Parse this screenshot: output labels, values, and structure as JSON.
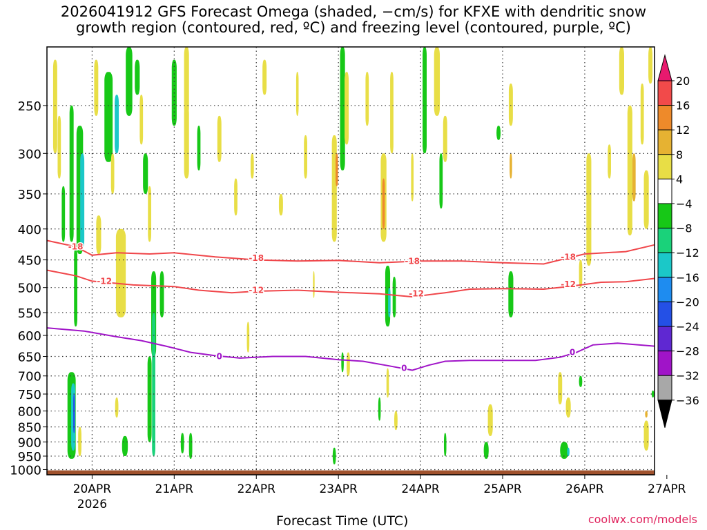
{
  "title": {
    "line1": "2026041912 GFS Forecast Omega (shaded, −cm/s) for KFXE with dendritic snow",
    "line2": "growth region (contoured, red, ºC) and freezing level (contoured, purple, ºC)"
  },
  "credit": "coolwx.com/models",
  "chart_data": {
    "type": "heatmap",
    "xlabel": "Forecast Time (UTC)",
    "ylabel": "",
    "x_ticks": [
      "20APR",
      "21APR",
      "22APR",
      "23APR",
      "24APR",
      "25APR",
      "26APR",
      "27APR"
    ],
    "x_sublabel": {
      "tick": "20APR",
      "text": "2026"
    },
    "x_range_days": [
      -0.55,
      6.85
    ],
    "y_ticks": [
      250,
      300,
      350,
      400,
      450,
      500,
      550,
      600,
      650,
      700,
      750,
      800,
      850,
      900,
      950,
      1000
    ],
    "y_range_hpa": [
      200,
      1020
    ],
    "grid": true,
    "colorbar": {
      "labels": [
        20,
        16,
        12,
        8,
        4,
        -4,
        -8,
        -12,
        -16,
        -20,
        -24,
        -28,
        -32,
        -36
      ],
      "colors": [
        "#e8196e",
        "#f24a4a",
        "#ee8a2a",
        "#e6b232",
        "#e8de46",
        "#ffffff",
        "#17c817",
        "#1ad27a",
        "#1bc8c8",
        "#1e8cf0",
        "#2450e6",
        "#5f28d2",
        "#a014c8",
        "#a8a8a8",
        "#000000"
      ]
    },
    "contours": [
      {
        "label": "-18",
        "color": "#f0464a",
        "kind": "dendritic",
        "points": [
          [
            -0.55,
            418
          ],
          [
            -0.2,
            428
          ],
          [
            0,
            442
          ],
          [
            0.3,
            438
          ],
          [
            0.7,
            440
          ],
          [
            1.0,
            438
          ],
          [
            1.5,
            445
          ],
          [
            2.0,
            450
          ],
          [
            2.5,
            452
          ],
          [
            3.0,
            451
          ],
          [
            3.5,
            455
          ],
          [
            4.0,
            452
          ],
          [
            4.5,
            452
          ],
          [
            5.0,
            455
          ],
          [
            5.5,
            457
          ],
          [
            5.7,
            450
          ],
          [
            6.0,
            440
          ],
          [
            6.5,
            436
          ],
          [
            6.85,
            425
          ]
        ]
      },
      {
        "label": "-12",
        "color": "#f0464a",
        "kind": "dendritic",
        "points": [
          [
            -0.55,
            468
          ],
          [
            -0.2,
            478
          ],
          [
            0,
            488
          ],
          [
            0.5,
            495
          ],
          [
            1.0,
            498
          ],
          [
            1.3,
            505
          ],
          [
            1.7,
            510
          ],
          [
            2.0,
            507
          ],
          [
            2.5,
            505
          ],
          [
            3.0,
            509
          ],
          [
            3.5,
            512
          ],
          [
            3.9,
            518
          ],
          [
            4.3,
            510
          ],
          [
            4.6,
            503
          ],
          [
            5.0,
            502
          ],
          [
            5.5,
            503
          ],
          [
            5.8,
            498
          ],
          [
            6.2,
            490
          ],
          [
            6.5,
            489
          ],
          [
            6.85,
            483
          ]
        ]
      },
      {
        "label": "0",
        "color": "#a014c8",
        "kind": "freezing",
        "points": [
          [
            -0.55,
            583
          ],
          [
            -0.1,
            590
          ],
          [
            0.3,
            603
          ],
          [
            0.6,
            612
          ],
          [
            0.9,
            625
          ],
          [
            1.2,
            640
          ],
          [
            1.5,
            648
          ],
          [
            1.8,
            654
          ],
          [
            2.2,
            650
          ],
          [
            2.6,
            650
          ],
          [
            3.0,
            658
          ],
          [
            3.3,
            662
          ],
          [
            3.6,
            673
          ],
          [
            3.9,
            685
          ],
          [
            4.1,
            672
          ],
          [
            4.3,
            662
          ],
          [
            4.6,
            660
          ],
          [
            5.0,
            660
          ],
          [
            5.4,
            660
          ],
          [
            5.7,
            652
          ],
          [
            5.9,
            640
          ],
          [
            6.1,
            622
          ],
          [
            6.4,
            618
          ],
          [
            6.85,
            625
          ]
        ]
      }
    ],
    "contour_labels": [
      {
        "text": "-18",
        "day": -0.2,
        "hpa": 428
      },
      {
        "text": "-18",
        "day": 2.0,
        "hpa": 447
      },
      {
        "text": "-18",
        "day": 3.9,
        "hpa": 452
      },
      {
        "text": "-18",
        "day": 5.8,
        "hpa": 445
      },
      {
        "text": "-12",
        "day": 0.15,
        "hpa": 488
      },
      {
        "text": "-12",
        "day": 2.0,
        "hpa": 505
      },
      {
        "text": "-12",
        "day": 3.95,
        "hpa": 512
      },
      {
        "text": "-12",
        "day": 5.8,
        "hpa": 494
      },
      {
        "text": "0",
        "day": 1.55,
        "hpa": 650
      },
      {
        "text": "0",
        "day": 3.8,
        "hpa": 680
      },
      {
        "text": "0",
        "day": 5.85,
        "hpa": 640
      }
    ],
    "omega_cells": [
      {
        "day": -0.45,
        "hpa": [
          210,
          300
        ],
        "w": 0.05,
        "val": 4
      },
      {
        "day": -0.4,
        "hpa": [
          260,
          330
        ],
        "w": 0.04,
        "val": 4
      },
      {
        "day": -0.35,
        "hpa": [
          340,
          420
        ],
        "w": 0.04,
        "val": -6
      },
      {
        "day": -0.25,
        "hpa": [
          250,
          420
        ],
        "w": 0.05,
        "val": -6
      },
      {
        "day": -0.15,
        "hpa": [
          270,
          440
        ],
        "w": 0.08,
        "val": -6
      },
      {
        "day": -0.12,
        "hpa": [
          300,
          430
        ],
        "w": 0.05,
        "val": -14
      },
      {
        "day": -0.2,
        "hpa": [
          430,
          580
        ],
        "w": 0.04,
        "val": -6
      },
      {
        "day": -0.25,
        "hpa": [
          690,
          960
        ],
        "w": 0.1,
        "val": -6
      },
      {
        "day": -0.23,
        "hpa": [
          720,
          930
        ],
        "w": 0.05,
        "val": -14
      },
      {
        "day": -0.22,
        "hpa": [
          750,
          870
        ],
        "w": 0.02,
        "val": -22
      },
      {
        "day": -0.15,
        "hpa": [
          850,
          950
        ],
        "w": 0.04,
        "val": 4
      },
      {
        "day": 0.05,
        "hpa": [
          210,
          260
        ],
        "w": 0.05,
        "val": 4
      },
      {
        "day": 0.08,
        "hpa": [
          380,
          440
        ],
        "w": 0.06,
        "val": 4
      },
      {
        "day": 0.2,
        "hpa": [
          220,
          310
        ],
        "w": 0.1,
        "val": -6
      },
      {
        "day": 0.3,
        "hpa": [
          240,
          300
        ],
        "w": 0.05,
        "val": -14
      },
      {
        "day": 0.25,
        "hpa": [
          300,
          350
        ],
        "w": 0.04,
        "val": 4
      },
      {
        "day": 0.35,
        "hpa": [
          400,
          560
        ],
        "w": 0.12,
        "val": 4
      },
      {
        "day": 0.4,
        "hpa": [
          880,
          950
        ],
        "w": 0.07,
        "val": -6
      },
      {
        "day": 0.3,
        "hpa": [
          760,
          820
        ],
        "w": 0.04,
        "val": 4
      },
      {
        "day": 0.45,
        "hpa": [
          200,
          260
        ],
        "w": 0.08,
        "val": -6
      },
      {
        "day": 0.55,
        "hpa": [
          210,
          240
        ],
        "w": 0.06,
        "val": -6
      },
      {
        "day": 0.6,
        "hpa": [
          240,
          290
        ],
        "w": 0.04,
        "val": 4
      },
      {
        "day": 0.65,
        "hpa": [
          300,
          350
        ],
        "w": 0.06,
        "val": -6
      },
      {
        "day": 0.7,
        "hpa": [
          340,
          420
        ],
        "w": 0.04,
        "val": 4
      },
      {
        "day": 0.75,
        "hpa": [
          470,
          650
        ],
        "w": 0.06,
        "val": -6
      },
      {
        "day": 0.75,
        "hpa": [
          550,
          950
        ],
        "w": 0.04,
        "val": -10
      },
      {
        "day": 0.7,
        "hpa": [
          650,
          900
        ],
        "w": 0.05,
        "val": -6
      },
      {
        "day": 0.85,
        "hpa": [
          470,
          560
        ],
        "w": 0.05,
        "val": -6
      },
      {
        "day": 1.0,
        "hpa": [
          210,
          270
        ],
        "w": 0.06,
        "val": -6
      },
      {
        "day": 1.15,
        "hpa": [
          250,
          330
        ],
        "w": 0.06,
        "val": 4
      },
      {
        "day": 1.1,
        "hpa": [
          870,
          940
        ],
        "w": 0.04,
        "val": -6
      },
      {
        "day": 1.2,
        "hpa": [
          870,
          960
        ],
        "w": 0.04,
        "val": -6
      },
      {
        "day": 1.15,
        "hpa": [
          200,
          260
        ],
        "w": 0.06,
        "val": 4
      },
      {
        "day": 1.3,
        "hpa": [
          270,
          320
        ],
        "w": 0.04,
        "val": -6
      },
      {
        "day": 1.55,
        "hpa": [
          260,
          310
        ],
        "w": 0.05,
        "val": 4
      },
      {
        "day": 1.75,
        "hpa": [
          330,
          380
        ],
        "w": 0.04,
        "val": 4
      },
      {
        "day": 1.95,
        "hpa": [
          300,
          330
        ],
        "w": 0.04,
        "val": 4
      },
      {
        "day": 1.9,
        "hpa": [
          570,
          640
        ],
        "w": 0.03,
        "val": 4
      },
      {
        "day": 2.1,
        "hpa": [
          210,
          240
        ],
        "w": 0.05,
        "val": 4
      },
      {
        "day": 2.3,
        "hpa": [
          350,
          380
        ],
        "w": 0.05,
        "val": 4
      },
      {
        "day": 2.5,
        "hpa": [
          220,
          260
        ],
        "w": 0.03,
        "val": 4
      },
      {
        "day": 2.6,
        "hpa": [
          280,
          330
        ],
        "w": 0.04,
        "val": 4
      },
      {
        "day": 2.7,
        "hpa": [
          470,
          520
        ],
        "w": 0.02,
        "val": 4
      },
      {
        "day": 2.95,
        "hpa": [
          280,
          420
        ],
        "w": 0.06,
        "val": 4
      },
      {
        "day": 2.98,
        "hpa": [
          300,
          340
        ],
        "w": 0.03,
        "val": 12
      },
      {
        "day": 3.05,
        "hpa": [
          200,
          320
        ],
        "w": 0.06,
        "val": -6
      },
      {
        "day": 3.1,
        "hpa": [
          220,
          290
        ],
        "w": 0.05,
        "val": 4
      },
      {
        "day": 3.05,
        "hpa": [
          640,
          690
        ],
        "w": 0.03,
        "val": -6
      },
      {
        "day": 3.12,
        "hpa": [
          640,
          700
        ],
        "w": 0.04,
        "val": 4
      },
      {
        "day": 2.95,
        "hpa": [
          920,
          980
        ],
        "w": 0.04,
        "val": -6
      },
      {
        "day": 3.35,
        "hpa": [
          220,
          270
        ],
        "w": 0.04,
        "val": 4
      },
      {
        "day": 3.55,
        "hpa": [
          300,
          420
        ],
        "w": 0.07,
        "val": 4
      },
      {
        "day": 3.55,
        "hpa": [
          330,
          400
        ],
        "w": 0.03,
        "val": 12
      },
      {
        "day": 3.6,
        "hpa": [
          460,
          580
        ],
        "w": 0.06,
        "val": -6
      },
      {
        "day": 3.62,
        "hpa": [
          500,
          560
        ],
        "w": 0.03,
        "val": -14
      },
      {
        "day": 3.68,
        "hpa": [
          480,
          560
        ],
        "w": 0.04,
        "val": -6
      },
      {
        "day": 3.65,
        "hpa": [
          220,
          300
        ],
        "w": 0.04,
        "val": 4
      },
      {
        "day": 3.7,
        "hpa": [
          800,
          860
        ],
        "w": 0.04,
        "val": 4
      },
      {
        "day": 3.6,
        "hpa": [
          680,
          760
        ],
        "w": 0.03,
        "val": 4
      },
      {
        "day": 3.5,
        "hpa": [
          760,
          830
        ],
        "w": 0.03,
        "val": -6
      },
      {
        "day": 3.9,
        "hpa": [
          300,
          360
        ],
        "w": 0.03,
        "val": 4
      },
      {
        "day": 4.05,
        "hpa": [
          200,
          300
        ],
        "w": 0.05,
        "val": -6
      },
      {
        "day": 4.2,
        "hpa": [
          200,
          260
        ],
        "w": 0.07,
        "val": 4
      },
      {
        "day": 4.3,
        "hpa": [
          260,
          310
        ],
        "w": 0.05,
        "val": 4
      },
      {
        "day": 4.25,
        "hpa": [
          300,
          370
        ],
        "w": 0.04,
        "val": -6
      },
      {
        "day": 4.3,
        "hpa": [
          870,
          950
        ],
        "w": 0.03,
        "val": -6
      },
      {
        "day": 4.85,
        "hpa": [
          780,
          880
        ],
        "w": 0.06,
        "val": 4
      },
      {
        "day": 4.8,
        "hpa": [
          900,
          960
        ],
        "w": 0.06,
        "val": -6
      },
      {
        "day": 4.95,
        "hpa": [
          270,
          285
        ],
        "w": 0.05,
        "val": -6
      },
      {
        "day": 5.1,
        "hpa": [
          230,
          270
        ],
        "w": 0.05,
        "val": 4
      },
      {
        "day": 5.1,
        "hpa": [
          300,
          330
        ],
        "w": 0.03,
        "val": 10
      },
      {
        "day": 5.1,
        "hpa": [
          470,
          560
        ],
        "w": 0.06,
        "val": -6
      },
      {
        "day": 5.7,
        "hpa": [
          690,
          780
        ],
        "w": 0.05,
        "val": 4
      },
      {
        "day": 5.8,
        "hpa": [
          760,
          820
        ],
        "w": 0.06,
        "val": 4
      },
      {
        "day": 5.75,
        "hpa": [
          900,
          960
        ],
        "w": 0.1,
        "val": -6
      },
      {
        "day": 5.8,
        "hpa": [
          920,
          950
        ],
        "w": 0.03,
        "val": -14
      },
      {
        "day": 5.95,
        "hpa": [
          700,
          730
        ],
        "w": 0.04,
        "val": -6
      },
      {
        "day": 5.95,
        "hpa": [
          450,
          500
        ],
        "w": 0.04,
        "val": 4
      },
      {
        "day": 6.05,
        "hpa": [
          300,
          460
        ],
        "w": 0.06,
        "val": 4
      },
      {
        "day": 6.3,
        "hpa": [
          290,
          330
        ],
        "w": 0.04,
        "val": 4
      },
      {
        "day": 6.45,
        "hpa": [
          200,
          240
        ],
        "w": 0.06,
        "val": 4
      },
      {
        "day": 6.55,
        "hpa": [
          250,
          410
        ],
        "w": 0.06,
        "val": 4
      },
      {
        "day": 6.6,
        "hpa": [
          300,
          360
        ],
        "w": 0.04,
        "val": 10
      },
      {
        "day": 6.7,
        "hpa": [
          230,
          290
        ],
        "w": 0.04,
        "val": 4
      },
      {
        "day": 6.75,
        "hpa": [
          320,
          400
        ],
        "w": 0.06,
        "val": 4
      },
      {
        "day": 6.8,
        "hpa": [
          200,
          230
        ],
        "w": 0.05,
        "val": 4
      },
      {
        "day": 6.75,
        "hpa": [
          830,
          930
        ],
        "w": 0.06,
        "val": 4
      },
      {
        "day": 6.75,
        "hpa": [
          800,
          820
        ],
        "w": 0.03,
        "val": 10
      },
      {
        "day": 6.83,
        "hpa": [
          740,
          760
        ],
        "w": 0.03,
        "val": -6
      }
    ]
  }
}
